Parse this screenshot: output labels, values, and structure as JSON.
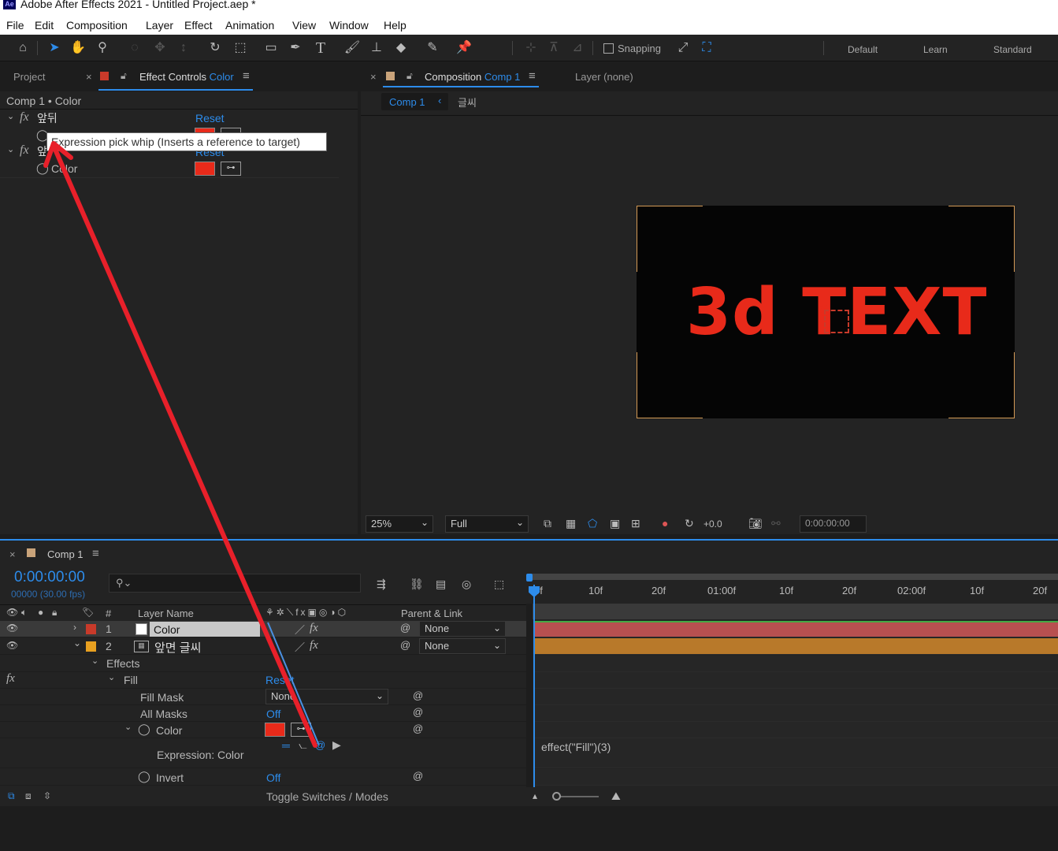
{
  "window": {
    "title": "Adobe After Effects 2021 - Untitled Project.aep *",
    "app_icon": "Ae"
  },
  "menu": [
    "File",
    "Edit",
    "Composition",
    "Layer",
    "Effect",
    "Animation",
    "View",
    "Window",
    "Help"
  ],
  "toolbar": {
    "snapping": "Snapping",
    "workspaces": [
      "Default",
      "Learn",
      "Standard"
    ]
  },
  "left_panel": {
    "tab_project": "Project",
    "tab_effect_controls": "Effect Controls",
    "tab_effect_controls_target": "Color",
    "breadcrumb": "Comp 1 • Color",
    "effect1_name": "앞뒤",
    "effect1_reset": "Reset",
    "effect2_name": "앞",
    "effect2_reset": "Reset",
    "effect2_prop": "Color",
    "tooltip": "Expression pick whip (Inserts a reference to target)"
  },
  "comp_panel": {
    "tab_label": "Composition",
    "tab_target": "Comp 1",
    "layer_tab": "Layer (none)",
    "breadcrumb_comp": "Comp 1",
    "breadcrumb_layer": "글씨",
    "canvas_text": "3d TEXT",
    "zoom": "25%",
    "resolution": "Full",
    "exposure": "+0.0",
    "timecode": "0:00:00:00"
  },
  "timeline": {
    "tab": "Comp 1",
    "timecode": "0:00:00:00",
    "frames": "00000 (30.00 fps)",
    "header_num": "#",
    "header_layer_name": "Layer Name",
    "header_parent": "Parent & Link",
    "ruler": [
      "0f",
      "10f",
      "20f",
      "01:00f",
      "10f",
      "20f",
      "02:00f",
      "10f",
      "20f"
    ],
    "layers": [
      {
        "num": "1",
        "name": "Color",
        "parent": "None",
        "label_color": "#c83a2a"
      },
      {
        "num": "2",
        "name": "앞면 글씨",
        "parent": "None",
        "label_color": "#e8a020"
      }
    ],
    "props": {
      "effects": "Effects",
      "fill": "Fill",
      "fill_reset": "Reset",
      "fill_mask": "Fill Mask",
      "fill_mask_value": "None",
      "all_masks": "All Masks",
      "all_masks_value": "Off",
      "color": "Color",
      "expression_label": "Expression: Color",
      "invert": "Invert",
      "invert_value": "Off"
    },
    "expression_text": "effect(\"Fill\")(3)",
    "toggle_label": "Toggle Switches / Modes"
  },
  "colors": {
    "accent": "#2d8ceb",
    "red_swatch": "#e82a1a",
    "layer1_bar": "#b85050",
    "layer2_bar": "#b8792a",
    "arrow": "#e8202a"
  }
}
